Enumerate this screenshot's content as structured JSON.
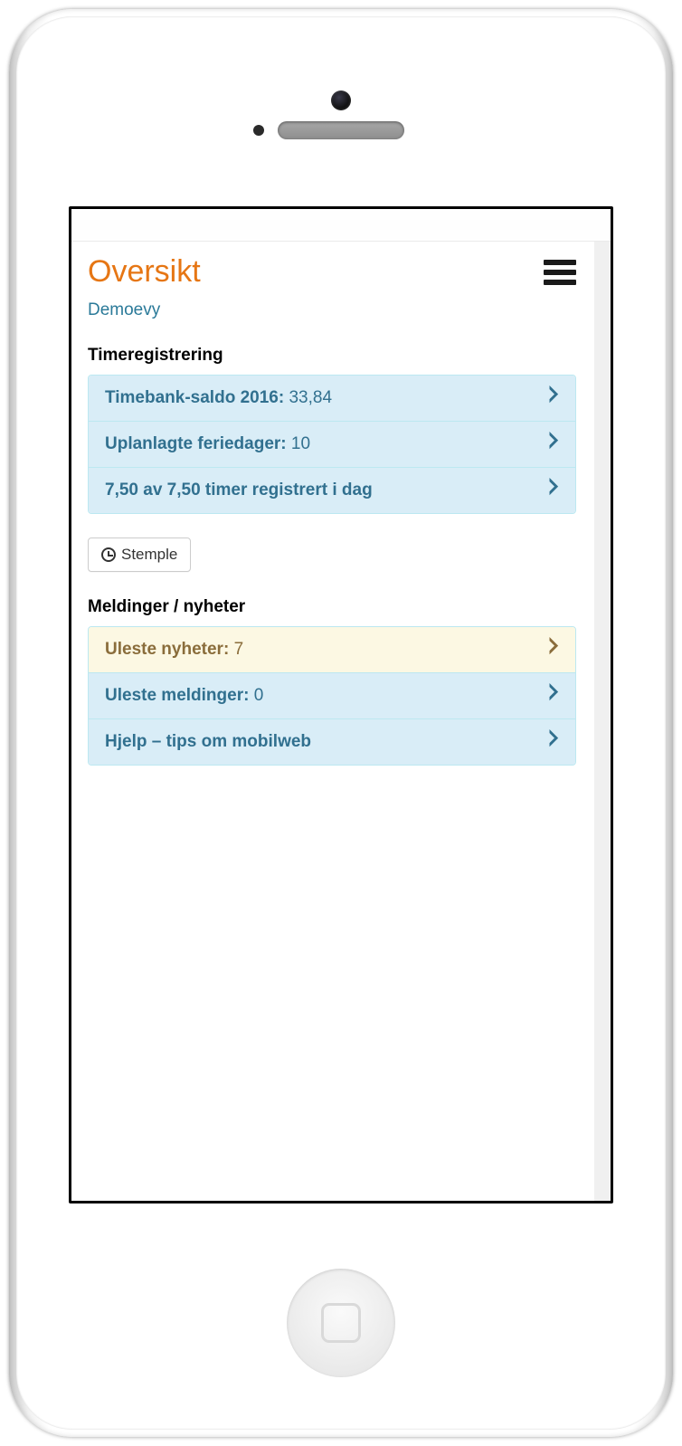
{
  "header": {
    "title": "Oversikt",
    "subtitle": "Demoevy"
  },
  "sections": {
    "time": {
      "title": "Timeregistrering",
      "items": [
        {
          "label": "Timebank-saldo 2016:",
          "value": "33,84",
          "style": "info"
        },
        {
          "label": "Uplanlagte feriedager:",
          "value": "10",
          "style": "info"
        },
        {
          "label": "7,50 av 7,50 timer registrert i dag",
          "value": "",
          "style": "info"
        }
      ],
      "stamp_button": "Stemple"
    },
    "messages": {
      "title": "Meldinger / nyheter",
      "items": [
        {
          "label": "Uleste nyheter:",
          "value": "7",
          "style": "warning"
        },
        {
          "label": "Uleste meldinger:",
          "value": "0",
          "style": "info"
        },
        {
          "label": "Hjelp – tips om mobilweb",
          "value": "",
          "style": "info"
        }
      ]
    }
  }
}
